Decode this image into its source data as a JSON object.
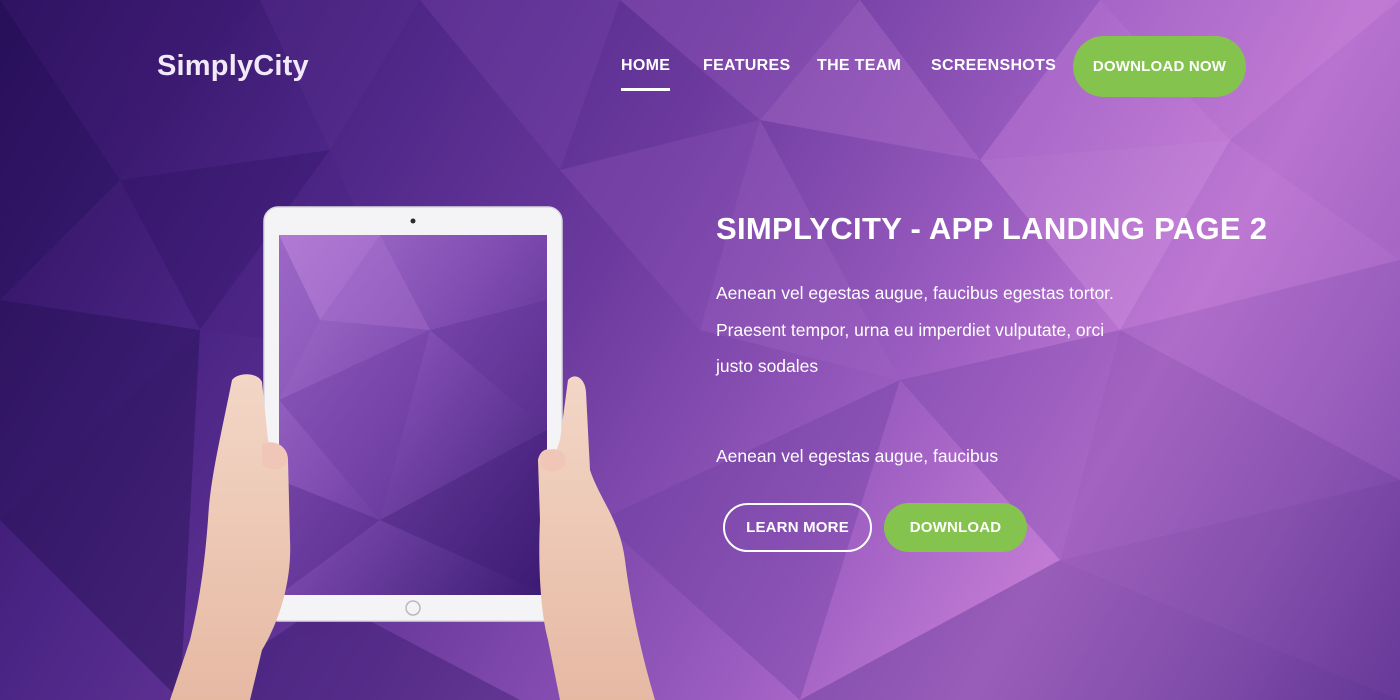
{
  "header": {
    "logo": "SimplyCity",
    "nav": [
      {
        "label": "HOME",
        "active": true
      },
      {
        "label": "FEATURES",
        "active": false
      },
      {
        "label": "THE TEAM",
        "active": false
      },
      {
        "label": "SCREENSHOTS",
        "active": false
      }
    ],
    "cta_label": "DOWNLOAD NOW"
  },
  "hero": {
    "title": "SIMPLYCITY - APP LANDING PAGE 2",
    "description": "Aenean vel egestas augue, faucibus egestas tortor. Praesent tempor, urna eu imperdiet vulputate, orci justo sodales",
    "subtext": "Aenean vel egestas augue, faucibus",
    "learn_more_label": "LEARN MORE",
    "download_label": "DOWNLOAD"
  },
  "colors": {
    "accent_green": "#84c34d",
    "bg_dark": "#2a0f5a",
    "bg_light": "#c27bd4"
  },
  "icons": [
    "tablet-device",
    "hands"
  ]
}
